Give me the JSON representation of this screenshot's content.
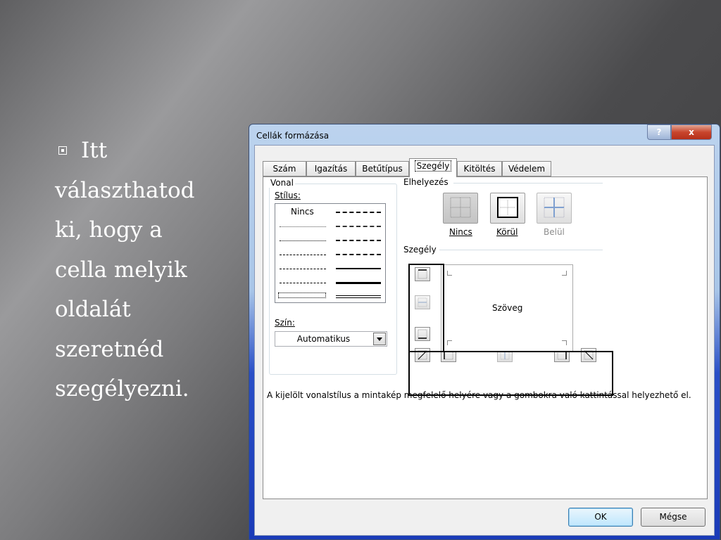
{
  "slide": {
    "lines": [
      "Itt",
      "választhatod",
      "ki, hogy a",
      "cella melyik",
      "oldalát",
      "szeretnéd",
      "szegélyezni."
    ]
  },
  "dialog": {
    "title": "Cellák formázása",
    "help": "?",
    "close": "x",
    "tabs": [
      "Szám",
      "Igazítás",
      "Betűtípus",
      "Szegély",
      "Kitöltés",
      "Védelem"
    ],
    "active_tab": "Szegély",
    "line_group": {
      "label": "Vonal",
      "style_label": "Stílus:",
      "none_option": "Nincs",
      "color_label": "Szín:",
      "color_value": "Automatikus"
    },
    "presets": {
      "label": "Elhelyezés",
      "buttons": [
        "Nincs",
        "Körül",
        "Belül"
      ]
    },
    "border": {
      "label": "Szegély",
      "preview_text": "Szöveg"
    },
    "hint": "A kijelölt vonalstílus a mintakép megfelelő helyére vagy a gombokra való kattintással helyezhető el.",
    "ok": "OK",
    "cancel": "Mégse"
  }
}
